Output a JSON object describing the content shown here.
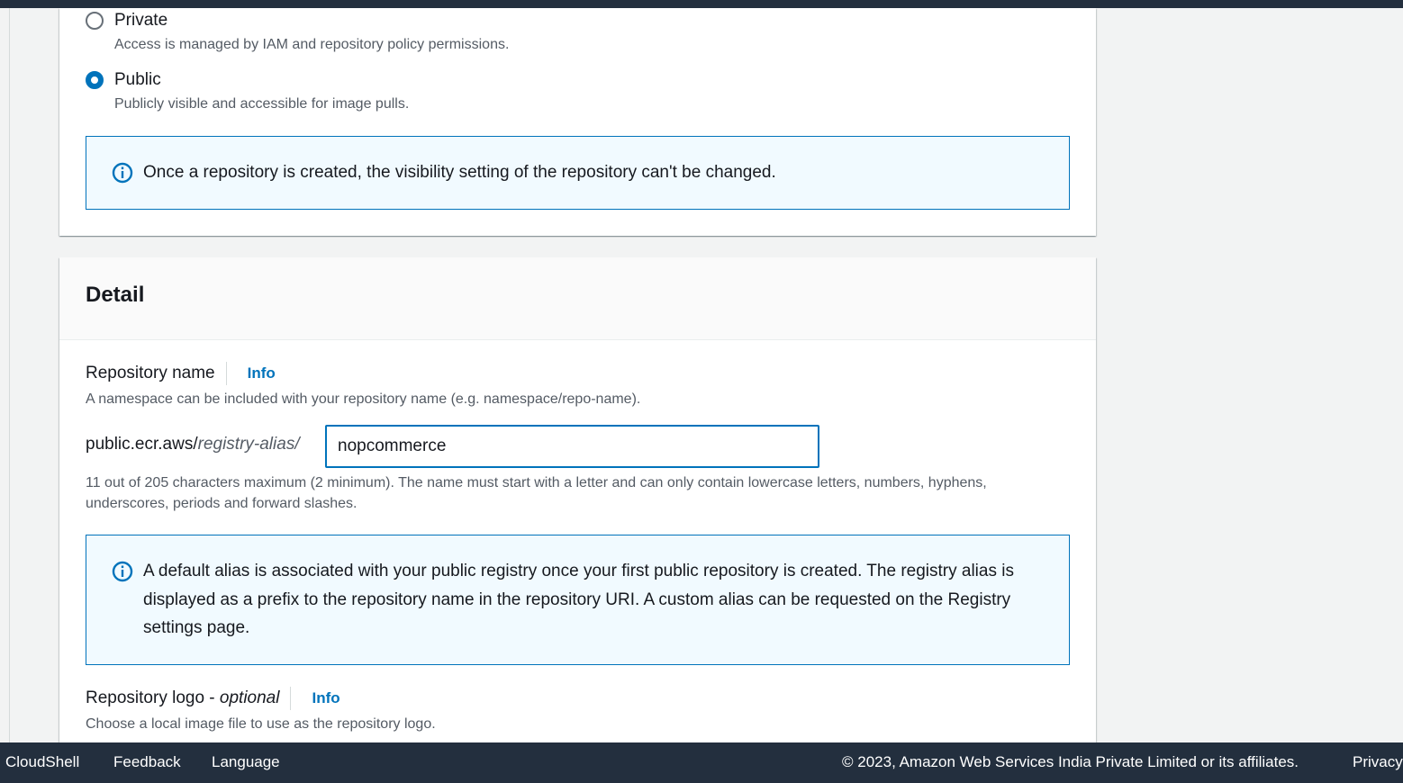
{
  "visibility": {
    "options": [
      {
        "label": "Private",
        "description": "Access is managed by IAM and repository policy permissions.",
        "selected": false
      },
      {
        "label": "Public",
        "description": "Publicly visible and accessible for image pulls.",
        "selected": true
      }
    ],
    "alert": "Once a repository is created, the visibility setting of the repository can't be changed."
  },
  "detail": {
    "title": "Detail",
    "repository_name": {
      "label": "Repository name",
      "info": "Info",
      "description": "A namespace can be included with your repository name (e.g. namespace/repo-name).",
      "prefix_static": "public.ecr.aws/",
      "prefix_alias": "registry-alias/",
      "value": "nopcommerce",
      "constraint": "11 out of 205 characters maximum (2 minimum). The name must start with a letter and can only contain lowercase letters, numbers, hyphens, underscores, periods and forward slashes."
    },
    "alias_alert": "A default alias is associated with your public registry once your first public repository is created. The registry alias is displayed as a prefix to the repository name in the repository URI. A custom alias can be requested on the Registry settings page.",
    "repository_logo": {
      "label": "Repository logo - ",
      "optional": "optional",
      "info": "Info",
      "description": "Choose a local image file to use as the repository logo."
    }
  },
  "footer": {
    "cloudshell": "CloudShell",
    "feedback": "Feedback",
    "language": "Language",
    "copyright": "© 2023, Amazon Web Services India Private Limited or its affiliates.",
    "privacy": "Privacy"
  },
  "colors": {
    "accent": "#0073bb",
    "navbar": "#232f3e",
    "alert_bg": "#f1faff"
  }
}
